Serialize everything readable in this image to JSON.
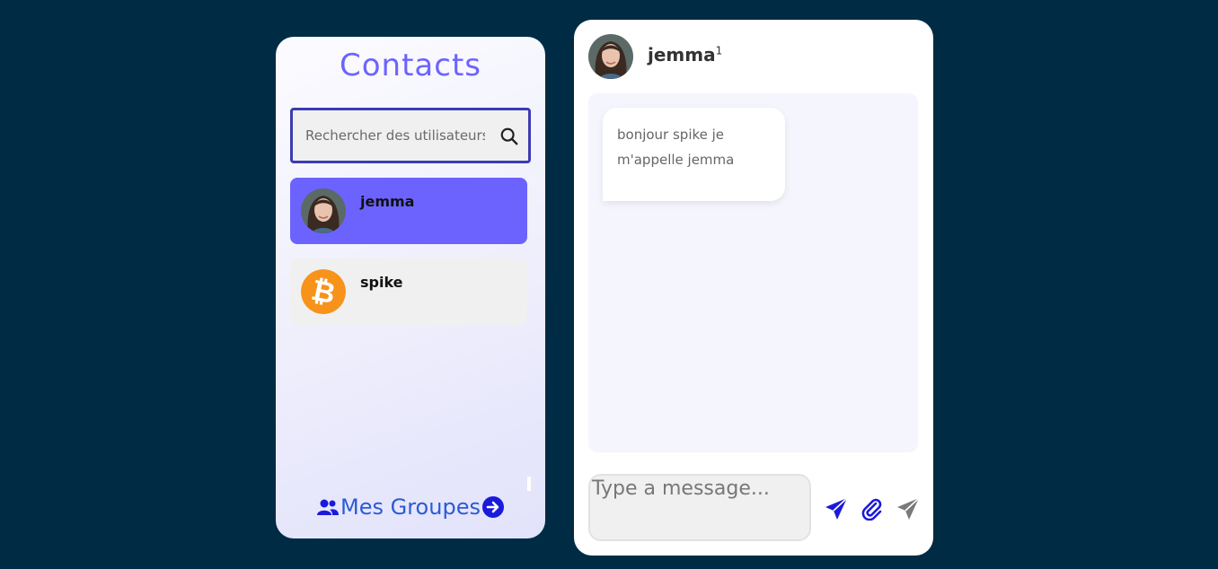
{
  "contacts_panel": {
    "title": "Contacts",
    "search": {
      "placeholder": "Rechercher des utilisateurs",
      "value": ""
    },
    "contacts": [
      {
        "name": "jemma",
        "avatar": "woman-portrait-avatar",
        "active": true
      },
      {
        "name": "spike",
        "avatar": "bitcoin-logo-avatar",
        "active": false
      }
    ],
    "groups_link": {
      "label": "Mes Groupes",
      "icon_left": "users-icon",
      "icon_right": "arrow-right-circle-icon"
    }
  },
  "chat_panel": {
    "contact_name": "jemma",
    "unread_count": "1",
    "messages": [
      {
        "text": "bonjour spike je m'appelle jemma",
        "side": "received"
      }
    ],
    "composer": {
      "placeholder": "Type a message...",
      "value": ""
    },
    "actions": [
      {
        "icon": "send-icon",
        "color": "#1a1adb"
      },
      {
        "icon": "paperclip-icon",
        "color": "#1a1adb"
      },
      {
        "icon": "send-icon",
        "color": "#7a7a7a"
      }
    ]
  },
  "colors": {
    "background": "#002b45",
    "accent": "#6c63ff",
    "link": "#2a5bd7",
    "action_blue": "#1a1adb"
  }
}
